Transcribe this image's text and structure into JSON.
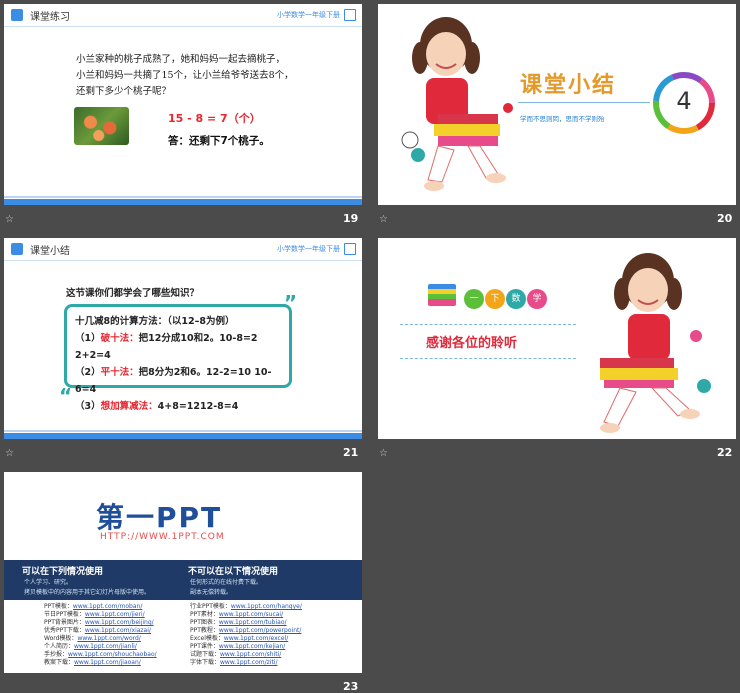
{
  "slides": {
    "s19": {
      "number": "19",
      "header": {
        "title": "课堂练习",
        "crumb": "小学数学一年级下册"
      },
      "problem": [
        "小兰家种的桃子成熟了，她和妈妈一起去摘桃子，",
        "小兰和妈妈一共摘了15个，让小兰给爷爷送去8个，",
        "还剩下多少个桃子呢？"
      ],
      "equation": "15 - 8 = 7（个）",
      "answer": "答：还剩下7个桃子。"
    },
    "s20": {
      "number": "20",
      "title": "课堂小结",
      "subtitle": "学而不思则罔，思而不学则殆",
      "circle_num": "4"
    },
    "s21": {
      "number": "21",
      "header": {
        "title": "课堂小结",
        "crumb": "小学数学一年级下册"
      },
      "question": "这节课你们都学会了哪些知识？",
      "box_title": "十几减8的计算方法：（以12–8为例）",
      "items": [
        {
          "prefix": "（1）",
          "method": "破十法：",
          "detail": "把12分成10和2。10-8=2 2+2=4"
        },
        {
          "prefix": "（2）",
          "method": "平十法：",
          "detail": "把8分为2和6。12-2=10 10-6=4"
        },
        {
          "prefix": "（3）",
          "method": "想加算减法：",
          "detail": "4+8=1212-8=4"
        }
      ]
    },
    "s22": {
      "number": "22",
      "badge": [
        "一",
        "下",
        "数",
        "学"
      ],
      "thanks": "感谢各位的聆听"
    },
    "s23": {
      "number": "23",
      "logo_text": "第一PPT",
      "url": "HTTP://WWW.1PPT.COM",
      "can_title": "可以在下列情况使用",
      "can_items": [
        "个人学习、研究。",
        "拷贝模板中的内容用于其它幻灯片母版中使用。"
      ],
      "cannot_title": "不可以在以下情况使用",
      "cannot_items": [
        "任何形式的在线付费下载。",
        "副本无偿转载。"
      ],
      "left_list": [
        {
          "k": "PPT模板：",
          "v": "www.1ppt.com/moban/"
        },
        {
          "k": "节日PPT模板：",
          "v": "www.1ppt.com/jieri/"
        },
        {
          "k": "PPT背景图片：",
          "v": "www.1ppt.com/beijing/"
        },
        {
          "k": "优秀PPT下载：",
          "v": "www.1ppt.com/xiazai/"
        },
        {
          "k": "Word模板：",
          "v": "www.1ppt.com/word/"
        },
        {
          "k": "个人简历：",
          "v": "www.1ppt.com/jianli/"
        },
        {
          "k": "手抄报：",
          "v": "www.1ppt.com/shouchaobao/"
        },
        {
          "k": "教案下载：",
          "v": "www.1ppt.com/jiaoan/"
        }
      ],
      "right_list": [
        {
          "k": "行业PPT模板：",
          "v": "www.1ppt.com/hangye/"
        },
        {
          "k": "PPT素材：",
          "v": "www.1ppt.com/sucai/"
        },
        {
          "k": "PPT图表：",
          "v": "www.1ppt.com/tubiao/"
        },
        {
          "k": "PPT教程：",
          "v": "www.1ppt.com/powerpoint/"
        },
        {
          "k": "Excel模板：",
          "v": "www.1ppt.com/excel/"
        },
        {
          "k": "PPT课件：",
          "v": "www.1ppt.com/kejian/"
        },
        {
          "k": "试题下载：",
          "v": "www.1ppt.com/shiti/"
        },
        {
          "k": "字体下载：",
          "v": "www.1ppt.com/ziti/"
        }
      ]
    }
  },
  "colors": {
    "accent": "#3b8ce5",
    "red": "#e8262e",
    "teal": "#2fa8a8",
    "navy": "#1f3a66"
  }
}
